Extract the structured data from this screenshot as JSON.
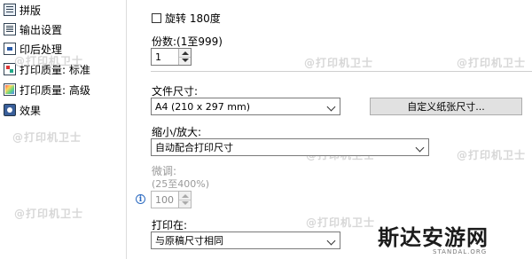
{
  "nav": {
    "items": [
      {
        "label": "拼版",
        "icon": "layout-icon"
      },
      {
        "label": "输出设置",
        "icon": "output-settings-icon"
      },
      {
        "label": "印后处理",
        "icon": "post-processing-icon"
      },
      {
        "label": "打印质量: 标准",
        "icon": "print-quality-standard-icon"
      },
      {
        "label": "打印质量: 高级",
        "icon": "print-quality-advanced-icon"
      },
      {
        "label": "效果",
        "icon": "effects-icon"
      }
    ]
  },
  "rotate": {
    "label": "旋转 180度",
    "checked": false
  },
  "copies": {
    "label": "份数:(1至999)",
    "value": "1"
  },
  "document_size": {
    "label": "文件尺寸:",
    "value": "A4 (210 x 297 mm)",
    "custom_button": "自定义纸张尺寸..."
  },
  "scale": {
    "label": "缩小/放大:",
    "value": "自动配合打印尺寸"
  },
  "fine_tune": {
    "label": "微调:",
    "range": "(25至400%)",
    "value": "100"
  },
  "print_on": {
    "label": "打印在:",
    "value": "与原稿尺寸相同"
  },
  "watermarks": {
    "text": "@打印机卫士",
    "brand": "斯达安游网",
    "brand_sub": "STANDAL.ORG"
  },
  "colors": {
    "accent": "#2d6bc1",
    "watermark": "#d7d7d7"
  }
}
